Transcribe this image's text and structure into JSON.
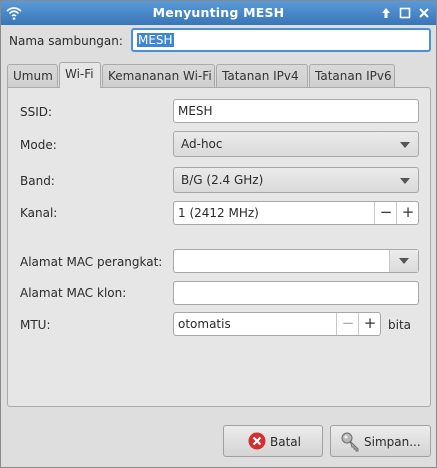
{
  "window": {
    "title": "Menyunting MESH",
    "icons": {
      "app": "wifi-icon",
      "up": "arrow-up-icon",
      "max": "maximize-icon",
      "close": "close-icon"
    }
  },
  "connection_name": {
    "label": "Nama sambungan:",
    "value": "MESH"
  },
  "tabs": [
    {
      "label": "Umum",
      "active": false
    },
    {
      "label": "Wi-Fi",
      "active": true
    },
    {
      "label": "Kemananan Wi-Fi",
      "active": false
    },
    {
      "label": "Tatanan IPv4",
      "active": false
    },
    {
      "label": "Tatanan IPv6",
      "active": false
    }
  ],
  "wifi": {
    "ssid": {
      "label": "SSID:",
      "value": "MESH"
    },
    "mode": {
      "label": "Mode:",
      "value": "Ad-hoc"
    },
    "band": {
      "label": "Band:",
      "value": "B/G (2.4 GHz)"
    },
    "channel": {
      "label": "Kanal:",
      "value": "1 (2412 MHz)",
      "minus": "−",
      "plus": "+"
    },
    "device_mac": {
      "label": "Alamat MAC perangkat:",
      "value": ""
    },
    "cloned_mac": {
      "label": "Alamat MAC klon:",
      "value": ""
    },
    "mtu": {
      "label": "MTU:",
      "value": "otomatis",
      "minus": "−",
      "plus": "+",
      "unit": "bita"
    }
  },
  "buttons": {
    "cancel": {
      "label": "Batal",
      "icon": "cancel-icon"
    },
    "save": {
      "label": "Simpan...",
      "icon": "key-icon"
    }
  },
  "colors": {
    "titlebar": "#3f80c4",
    "selection": "#3d86d4",
    "cancel_icon": "#d42f2f"
  }
}
